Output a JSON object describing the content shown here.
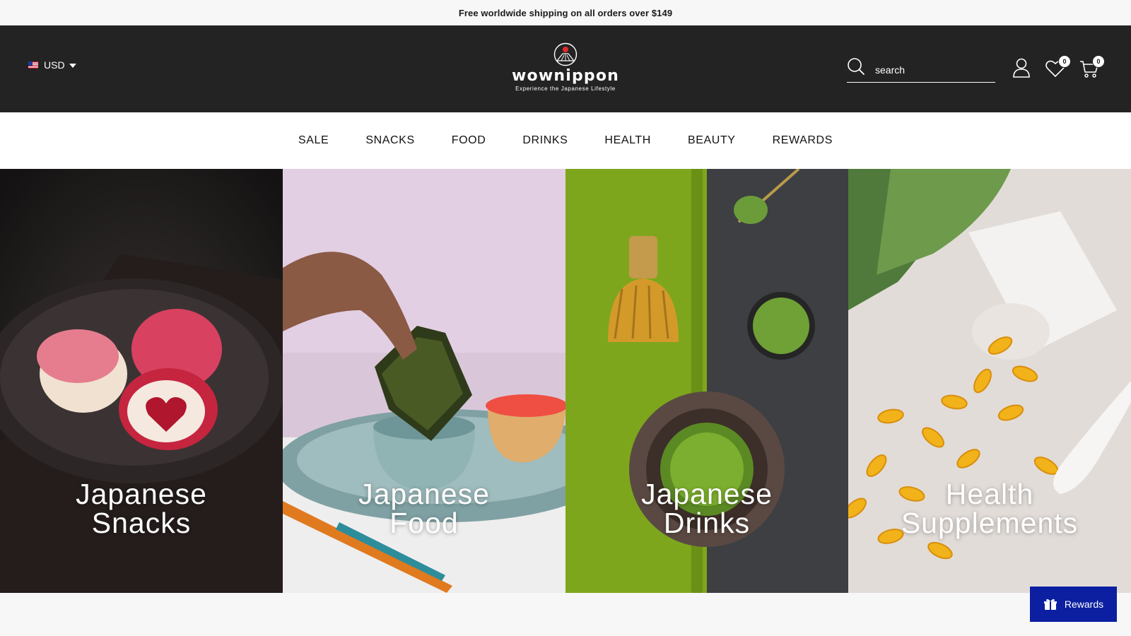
{
  "announcement": "Free worldwide shipping on all orders over $149",
  "header": {
    "currency": "USD",
    "logo_word": "wownippon",
    "logo_tagline": "Experience the Japanese Lifestyle",
    "search_placeholder": "search",
    "wishlist_count": "0",
    "cart_count": "0"
  },
  "nav": {
    "items": [
      "SALE",
      "SNACKS",
      "FOOD",
      "DRINKS",
      "HEALTH",
      "BEAUTY",
      "REWARDS"
    ]
  },
  "tiles": [
    {
      "line1": "Japanese",
      "line2": "Snacks"
    },
    {
      "line1": "Japanese",
      "line2": "Food"
    },
    {
      "line1": "Japanese",
      "line2": "Drinks"
    },
    {
      "line1": "Health",
      "line2": "Supplements"
    }
  ],
  "rewards_button": "Rewards",
  "colors": {
    "topbar": "#232323",
    "rewards_button": "#0b1fa0"
  }
}
